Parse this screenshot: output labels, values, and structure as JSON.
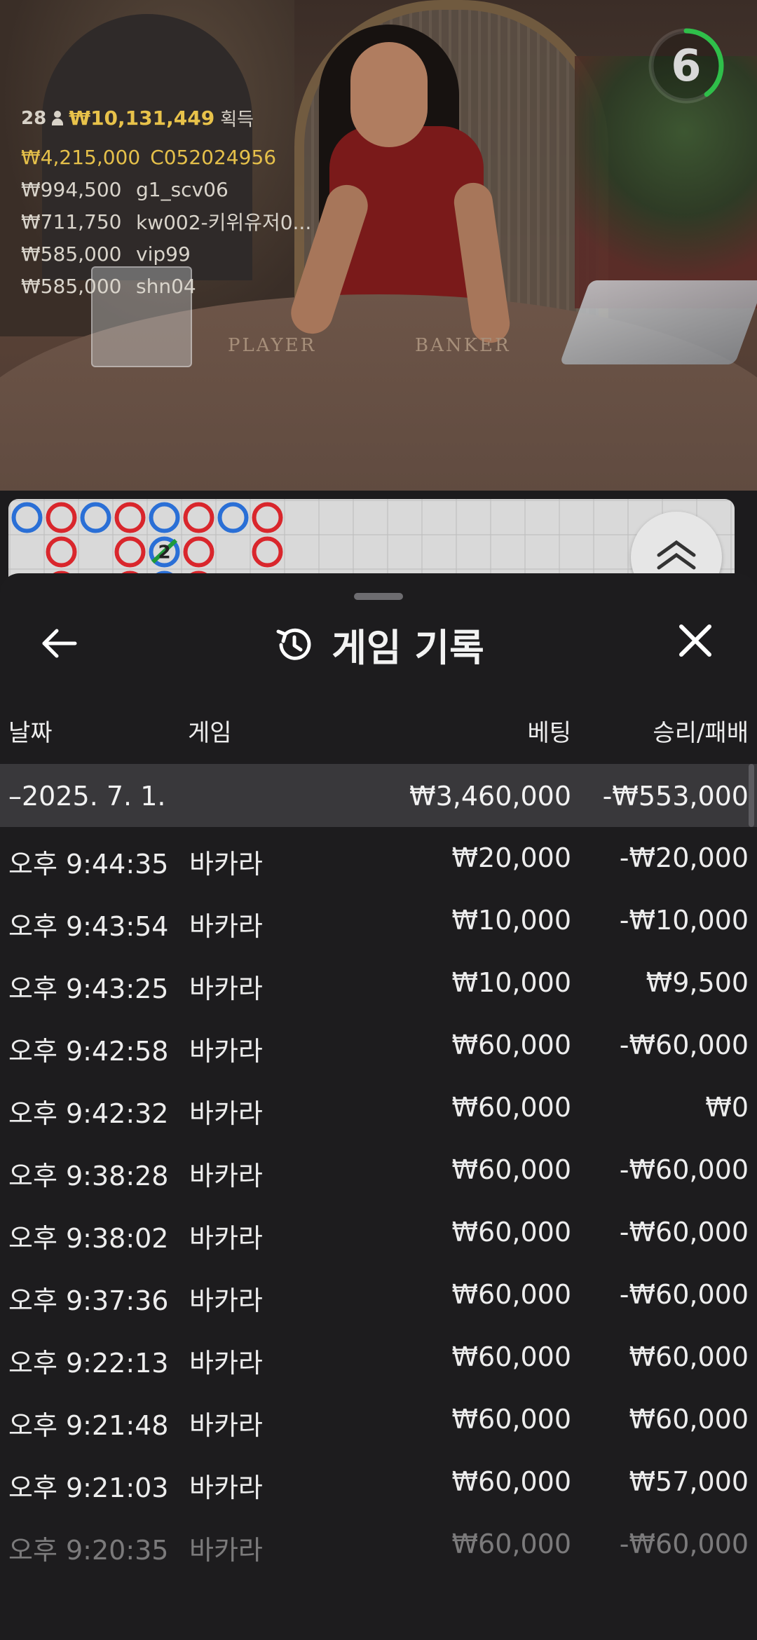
{
  "video": {
    "table_labels": [
      "PLAYER",
      "BANKER"
    ],
    "winners": {
      "count": "28",
      "total": "₩10,131,449",
      "suffix": "획득",
      "list": [
        {
          "amount": "₩4,215,000",
          "name": "C052024956"
        },
        {
          "amount": "₩994,500",
          "name": "g1_scv06"
        },
        {
          "amount": "₩711,750",
          "name": "kw002-키위유저0..."
        },
        {
          "amount": "₩585,000",
          "name": "vip99"
        },
        {
          "amount": "₩585,000",
          "name": "shn04"
        }
      ]
    },
    "timer": {
      "value": "6",
      "remaining_fraction": 0.4,
      "color": "#2fbf4a"
    }
  },
  "roadmap": {
    "player_color": "#2a6fd6",
    "banker_color": "#d9262c",
    "tie_color": "#1f9a3a",
    "marker_label": "2",
    "expand_icon": "double-chevron-up-icon"
  },
  "history": {
    "title": "게임 기록",
    "title_icon": "history-icon",
    "back_icon": "arrow-left-icon",
    "close_icon": "close-icon",
    "columns": {
      "date": "날짜",
      "game": "게임",
      "bet": "베팅",
      "result": "승리/패배"
    },
    "day": {
      "label": "–2025. 7. 1.",
      "bet": "₩3,460,000",
      "result": "-₩553,000"
    },
    "rows": [
      {
        "time": "오후 9:44:35",
        "game": "바카라",
        "bet": "₩20,000",
        "result": "-₩20,000"
      },
      {
        "time": "오후 9:43:54",
        "game": "바카라",
        "bet": "₩10,000",
        "result": "-₩10,000"
      },
      {
        "time": "오후 9:43:25",
        "game": "바카라",
        "bet": "₩10,000",
        "result": "₩9,500"
      },
      {
        "time": "오후 9:42:58",
        "game": "바카라",
        "bet": "₩60,000",
        "result": "-₩60,000"
      },
      {
        "time": "오후 9:42:32",
        "game": "바카라",
        "bet": "₩60,000",
        "result": "₩0"
      },
      {
        "time": "오후 9:38:28",
        "game": "바카라",
        "bet": "₩60,000",
        "result": "-₩60,000"
      },
      {
        "time": "오후 9:38:02",
        "game": "바카라",
        "bet": "₩60,000",
        "result": "-₩60,000"
      },
      {
        "time": "오후 9:37:36",
        "game": "바카라",
        "bet": "₩60,000",
        "result": "-₩60,000"
      },
      {
        "time": "오후 9:22:13",
        "game": "바카라",
        "bet": "₩60,000",
        "result": "₩60,000"
      },
      {
        "time": "오후 9:21:48",
        "game": "바카라",
        "bet": "₩60,000",
        "result": "₩60,000"
      },
      {
        "time": "오후 9:21:03",
        "game": "바카라",
        "bet": "₩60,000",
        "result": "₩57,000"
      },
      {
        "time": "오후 9:20:35",
        "game": "바카라",
        "bet": "₩60,000",
        "result": "-₩60,000"
      }
    ]
  }
}
